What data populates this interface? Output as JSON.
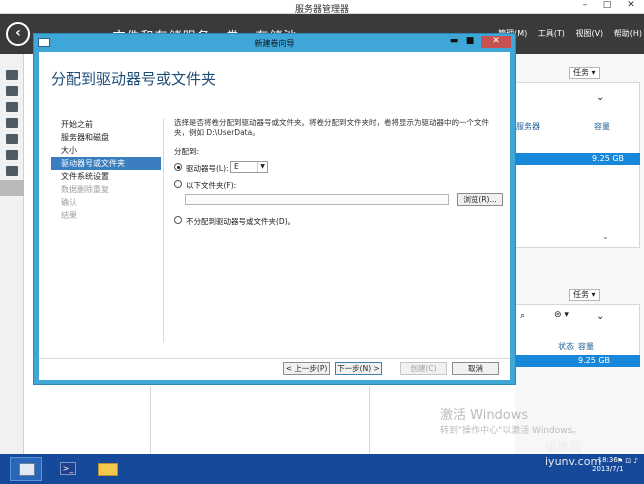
{
  "server_manager": {
    "title": "服务器管理器",
    "breadcrumb": "· · 文件和存储服务 · 卷 · 存储池",
    "menu": [
      "管理(M)",
      "工具(T)",
      "视图(V)",
      "帮助(H)"
    ],
    "win_controls": [
      "–",
      "□",
      "✕"
    ],
    "tasks_label": "任务",
    "col_server": "服务器",
    "col_capacity": "容量",
    "col_status": "状态",
    "row1_capacity": "9.25 GB",
    "row2_capacity": "9.25 GB",
    "sidebar_icons": [
      "dashboard-icon",
      "local-server-icon",
      "all-servers-icon",
      "roles-icon",
      "iis-icon",
      "print-icon",
      "storage-icon",
      "file-storage-icon"
    ]
  },
  "wizard": {
    "title": "新建卷向导",
    "heading": "分配到驱动器号或文件夹",
    "steps": [
      {
        "label": "开始之前",
        "state": "normal"
      },
      {
        "label": "服务器和磁盘",
        "state": "normal"
      },
      {
        "label": "大小",
        "state": "normal"
      },
      {
        "label": "驱动器号或文件夹",
        "state": "current"
      },
      {
        "label": "文件系统设置",
        "state": "normal"
      },
      {
        "label": "数据删除重复",
        "state": "disabled"
      },
      {
        "label": "确认",
        "state": "disabled"
      },
      {
        "label": "结果",
        "state": "disabled"
      }
    ],
    "description": "选择是否将卷分配到驱动器号或文件夹。将卷分配到文件夹时，卷将显示为驱动器中的一个文件夹，例如 D:\\UserData。",
    "assign_label": "分配到:",
    "option_drive": "驱动器号(L):",
    "drive_value": "E",
    "option_folder": "以下文件夹(F):",
    "folder_value": "",
    "browse_button": "浏览(R)...",
    "option_none": "不分配到驱动器号或文件夹(D)。",
    "prev_button": "< 上一步(P)",
    "next_button": "下一步(N) >",
    "create_button": "创建(C)",
    "cancel_button": "取消"
  },
  "watermark": {
    "activate_title": "激活 Windows",
    "activate_sub": "转到\"操作中心\"以激活 Windows。",
    "site_cn": "运维网",
    "site_en": "iyunv.com"
  },
  "taskbar": {
    "time": "18:36",
    "date": "2013/7/1"
  },
  "colors": {
    "accent": "#3fa7d8",
    "selected_step": "#3a7ebf",
    "header_dark": "#3a3a3a",
    "taskbar": "#16499a",
    "row_selected": "#1987d9"
  }
}
